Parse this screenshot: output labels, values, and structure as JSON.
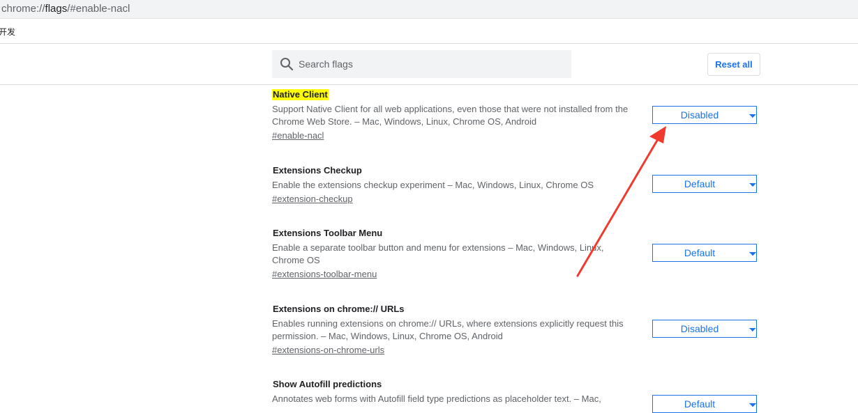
{
  "omnibox": {
    "url_scheme": "chrome://",
    "url_host": "flags",
    "url_path": "/#enable-nacl"
  },
  "bookmarks_bar": {
    "item": "开发"
  },
  "header": {
    "search_placeholder": "Search flags",
    "reset_label": "Reset all"
  },
  "flags": [
    {
      "title": "Native Client",
      "description": "Support Native Client for all web applications, even those that were not installed from the Chrome Web Store. – Mac, Windows, Linux, Chrome OS, Android",
      "permalink": "#enable-nacl",
      "value": "Disabled",
      "highlighted": true
    },
    {
      "title": "Extensions Checkup",
      "description": "Enable the extensions checkup experiment – Mac, Windows, Linux, Chrome OS",
      "permalink": "#extension-checkup",
      "value": "Default"
    },
    {
      "title": "Extensions Toolbar Menu",
      "description": "Enable a separate toolbar button and menu for extensions – Mac, Windows, Linux, Chrome OS",
      "permalink": "#extensions-toolbar-menu",
      "value": "Default"
    },
    {
      "title": "Extensions on chrome:// URLs",
      "description": "Enables running extensions on chrome:// URLs, where extensions explicitly request this permission. – Mac, Windows, Linux, Chrome OS, Android",
      "permalink": "#extensions-on-chrome-urls",
      "value": "Disabled"
    },
    {
      "title": "Show Autofill predictions",
      "description": "Annotates web forms with Autofill field type predictions as placeholder text. – Mac,",
      "permalink": "",
      "value": "Default"
    }
  ],
  "annotation": {
    "color": "#f03a2e"
  }
}
